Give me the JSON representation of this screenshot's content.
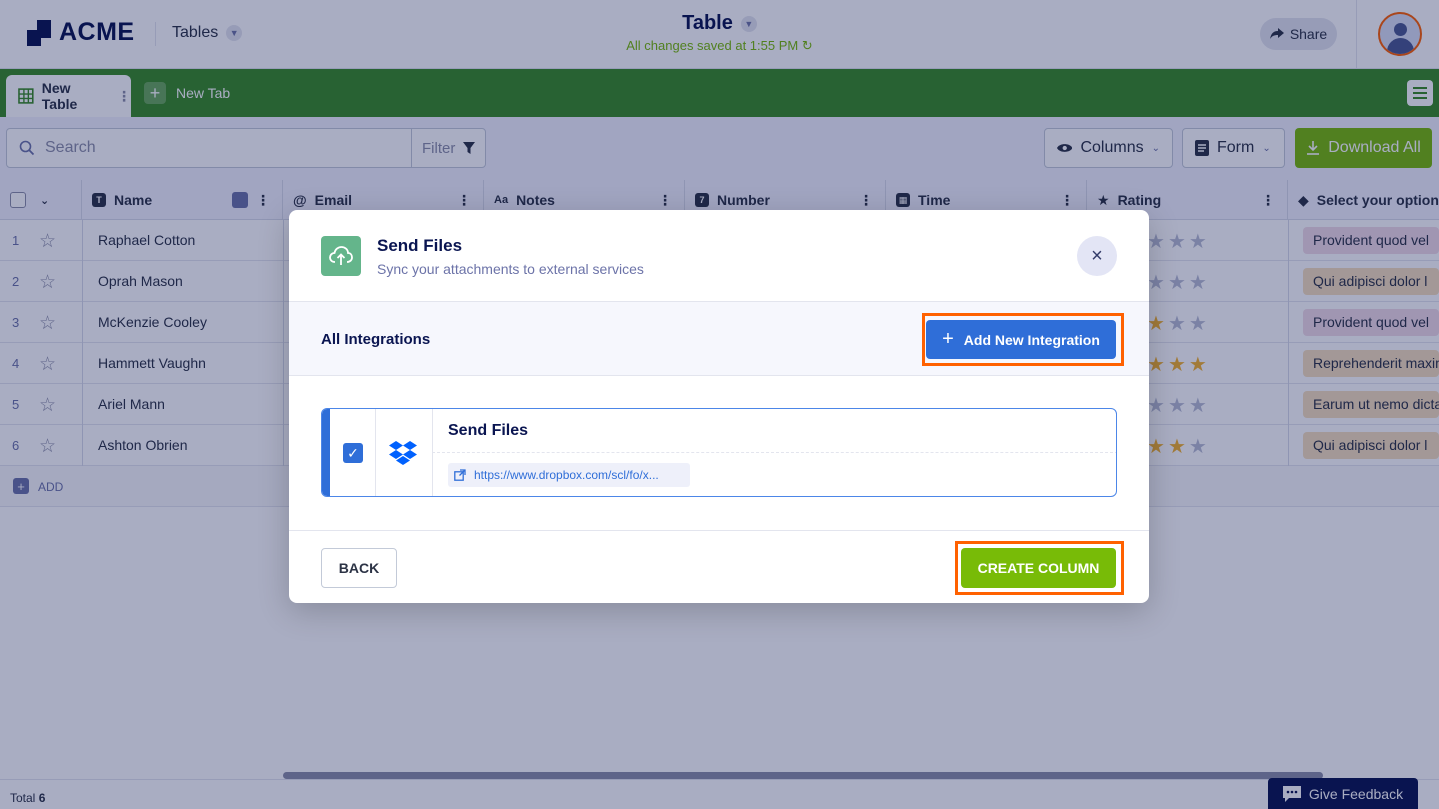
{
  "header": {
    "brand": "ACME",
    "section_label": "Tables",
    "title": "Table",
    "saved_status": "All changes saved at 1:55 PM",
    "share_label": "Share"
  },
  "tabs": {
    "active_label": "New Table",
    "new_tab_label": "New Tab"
  },
  "toolbar": {
    "search_placeholder": "Search",
    "filter_label": "Filter",
    "columns_label": "Columns",
    "form_label": "Form",
    "download_label": "Download All"
  },
  "table": {
    "columns": [
      "Name",
      "Email",
      "Notes",
      "Number",
      "Time",
      "Rating",
      "Select your option"
    ],
    "column_icons": [
      "text-icon",
      "at-icon",
      "notes-icon",
      "number-icon",
      "calendar-icon",
      "star-icon",
      "tag-icon"
    ],
    "rows": [
      {
        "num": "1",
        "name": "Raphael Cotton",
        "rating": 0,
        "option": "Provident quod vel",
        "option_color": "#f2dce7"
      },
      {
        "num": "2",
        "name": "Oprah Mason",
        "rating": 0,
        "option": "Qui adipisci dolor l",
        "option_color": "#f6dfbd"
      },
      {
        "num": "3",
        "name": "McKenzie Cooley",
        "rating": 1,
        "option": "Provident quod vel",
        "option_color": "#f2dce7"
      },
      {
        "num": "4",
        "name": "Hammett Vaughn",
        "rating": 3,
        "option": "Reprehenderit maxim",
        "option_color": "#f6dfbd"
      },
      {
        "num": "5",
        "name": "Ariel Mann",
        "rating": 0,
        "option": "Earum ut nemo dicta",
        "option_color": "#f6dfbd"
      },
      {
        "num": "6",
        "name": "Ashton Obrien",
        "rating": 2,
        "option": "Qui adipisci dolor l",
        "option_color": "#f6dfbd"
      }
    ],
    "add_label": "ADD"
  },
  "footer": {
    "total_label": "Total",
    "total_value": "6",
    "feedback_label": "Give Feedback"
  },
  "modal": {
    "title": "Send Files",
    "subtitle": "Sync your attachments to external services",
    "section_title": "All Integrations",
    "add_integration_label": "Add New Integration",
    "integration": {
      "name": "Send Files",
      "link": "https://www.dropbox.com/scl/fo/x...",
      "service_icon": "dropbox-icon"
    },
    "back_label": "BACK",
    "create_label": "CREATE COLUMN"
  },
  "colors": {
    "brand_navy": "#0a1551",
    "tab_green": "#3a8c24",
    "action_green": "#78bb07",
    "primary_blue": "#2f6ed8",
    "highlight_orange": "#ff6100",
    "star_gold": "#f4b22d"
  }
}
